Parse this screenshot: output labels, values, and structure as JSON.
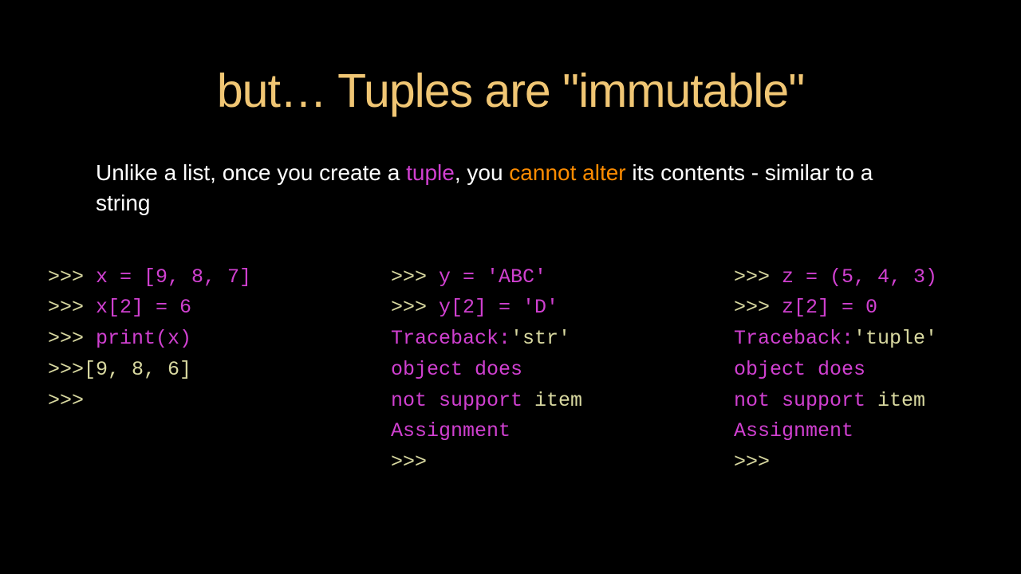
{
  "title": "but… Tuples are \"immutable\"",
  "subtitle": {
    "t1": "Unlike a list, once you create a ",
    "t2": "tuple",
    "t3": ", you ",
    "t4": "cannot alter",
    "t5": " its contents - similar to a string"
  },
  "col1": {
    "l1a": ">>> ",
    "l1b": "x = [9, 8, 7]",
    "l2a": ">>> ",
    "l2b": "x[2] = 6",
    "l3a": ">>> ",
    "l3b": "print(x)",
    "l4": ">>>[9, 8, 6]",
    "l5": ">>>"
  },
  "col2": {
    "l1a": ">>> ",
    "l1b": "y = 'ABC'",
    "l2a": ">>> ",
    "l2b": "y[2] = 'D'",
    "l3a": "Traceback:",
    "l3b": "'str' ",
    "l4": "object does",
    "l5a": "not support ",
    "l5b": "item",
    "l6": "Assignment",
    "l7": ">>>"
  },
  "col3": {
    "l1a": ">>> ",
    "l1b": "z = (5, 4, 3)",
    "l2a": ">>> ",
    "l2b": "z[2] = 0",
    "l3a": "Traceback:",
    "l3b": "'tuple' ",
    "l4": "object does",
    "l5a": "not support ",
    "l5b": "item",
    "l6": "Assignment",
    "l7": ">>>"
  }
}
